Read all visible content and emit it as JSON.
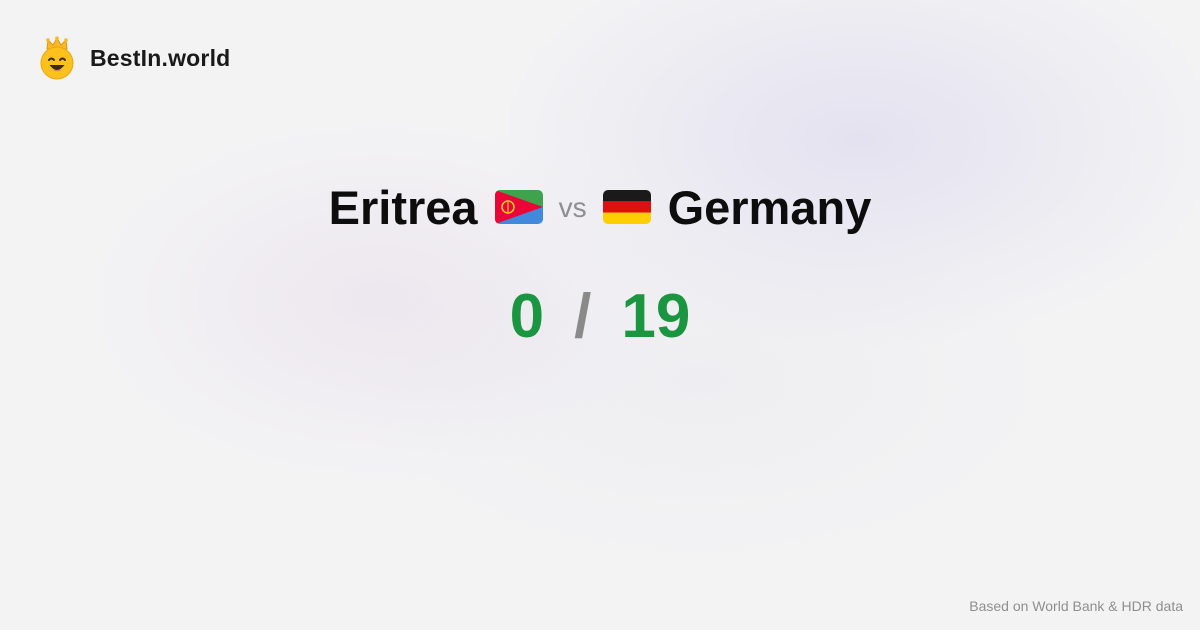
{
  "brand": {
    "name": "BestIn.world",
    "icon": "crowned-smiley-icon"
  },
  "comparison": {
    "country_a": "Eritrea",
    "country_a_flag": "eritrea-flag-icon",
    "vs_label": "vs",
    "country_b": "Germany",
    "country_b_flag": "germany-flag-icon"
  },
  "score": {
    "a": "0",
    "separator": "/",
    "b": "19"
  },
  "footer": {
    "source": "Based on World Bank & HDR data"
  },
  "colors": {
    "score_green": "#1a9640",
    "separator_gray": "#8a8a8a",
    "vs_gray": "#8e8e8e",
    "background": "#f3f3f4"
  }
}
